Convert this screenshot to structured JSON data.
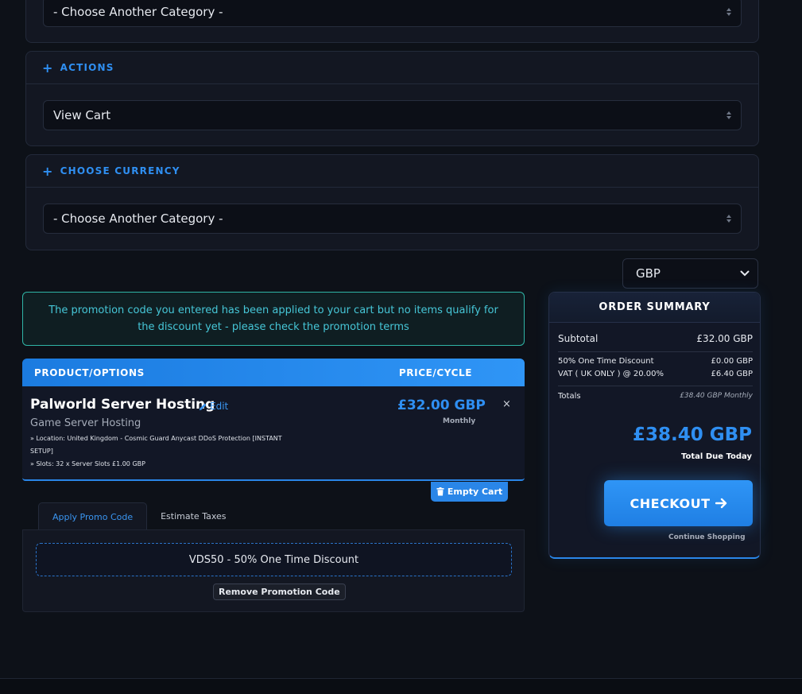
{
  "top_select": {
    "value": "- Choose Another Category -"
  },
  "actions": {
    "title": "ACTIONS",
    "select_value": "View Cart"
  },
  "choose_currency": {
    "title": "CHOOSE CURRENCY",
    "select_value": "- Choose Another Category -"
  },
  "currency_select": {
    "value": "GBP"
  },
  "alert": {
    "text": "The promotion code you entered has been applied to your cart but no items qualify for the discount yet - please check the promotion terms"
  },
  "cart": {
    "header_product": "PRODUCT/OPTIONS",
    "header_price": "PRICE/CYCLE",
    "product_name": "Palworld Server Hosting",
    "edit_label": "Edit",
    "product_group": "Game Server Hosting",
    "detail_1": "» Location: United Kingdom - Cosmic Guard Anycast DDoS Protection [INSTANT",
    "detail_1b": "SETUP]",
    "detail_2": "» Slots: 32 x Server Slots £1.00 GBP",
    "price": "£32.00 GBP",
    "cycle": "Monthly",
    "remove_icon": "×",
    "empty_cart_label": "Empty Cart"
  },
  "promo": {
    "tab_apply": "Apply Promo Code",
    "tab_taxes": "Estimate Taxes",
    "code": "VDS50 - 50% One Time Discount",
    "remove_label": "Remove Promotion Code"
  },
  "summary": {
    "title": "ORDER SUMMARY",
    "subtotal_label": "Subtotal",
    "subtotal_value": "£32.00 GBP",
    "discount_label": "50% One Time Discount",
    "discount_value": "£0.00 GBP",
    "vat_label": "VAT ( UK ONLY ) @ 20.00%",
    "vat_value": "£6.40 GBP",
    "totals_label": "Totals",
    "totals_value": "£38.40 GBP Monthly",
    "total_due": "£38.40 GBP",
    "total_due_label": "Total Due Today",
    "checkout_label": "CHECKOUT",
    "continue_label": "Continue Shopping"
  },
  "colors": {
    "accent": "#2f8ff2",
    "background": "#0d1118",
    "panel": "#131722",
    "alert": "#46c6d7"
  }
}
